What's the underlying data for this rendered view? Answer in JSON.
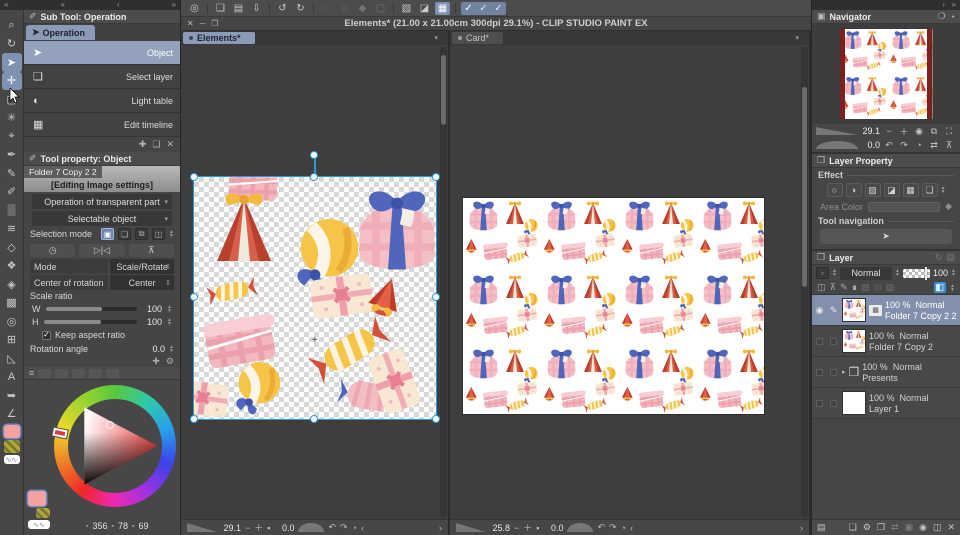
{
  "colors": {
    "accent_blue": "#8b9ab5",
    "handle_blue": "#2b98dd",
    "current_color": "#f2a3a1",
    "canvas_white": "#ffffff"
  },
  "window": {
    "title": "Elements* (21.00 x 21.00cm 300dpi 29.1%)  - CLIP STUDIO PAINT EX",
    "close": "✕",
    "minimize": "─",
    "maximize": "❐"
  },
  "top_strip": {
    "l1": "«",
    "l2": "«",
    "l3": "‹",
    "r1": "»",
    "nav_r1": "›",
    "nav_r2": "»"
  },
  "command_bar": {
    "icons": [
      {
        "name": "clip-studio-logo",
        "glyph": "◎"
      },
      {
        "name": "new-file",
        "glyph": "❑"
      },
      {
        "name": "open-file",
        "glyph": "▤"
      },
      {
        "name": "export",
        "glyph": "⇩"
      },
      {
        "name": "undo",
        "glyph": "↺"
      },
      {
        "name": "redo",
        "glyph": "↻"
      },
      {
        "name": "deselect",
        "glyph": "◌"
      },
      {
        "name": "reselect",
        "glyph": "○"
      },
      {
        "name": "invert-selection",
        "glyph": "◆"
      },
      {
        "name": "expand-selection",
        "glyph": "▢"
      },
      {
        "name": "selection-launcher",
        "glyph": "▧"
      },
      {
        "name": "crop",
        "glyph": "◪"
      },
      {
        "name": "show-grid",
        "glyph": "▦"
      },
      {
        "name": "snap-to-ruler",
        "glyph": "✓"
      },
      {
        "name": "snap-to-special-ruler",
        "glyph": "✓"
      },
      {
        "name": "snap-to-grid",
        "glyph": "✓"
      }
    ]
  },
  "tools": [
    {
      "name": "zoom",
      "glyph": "⌕"
    },
    {
      "name": "rotate-view",
      "glyph": "↻"
    },
    {
      "name": "object",
      "glyph": "➤"
    },
    {
      "name": "move-layer",
      "glyph": "✛"
    },
    {
      "name": "selection-marquee",
      "glyph": "▢"
    },
    {
      "name": "auto-select",
      "glyph": "✳"
    },
    {
      "name": "eyedropper",
      "glyph": "⌖"
    },
    {
      "name": "pen",
      "glyph": "✒"
    },
    {
      "name": "pencil",
      "glyph": "✎"
    },
    {
      "name": "brush",
      "glyph": "✐"
    },
    {
      "name": "airbrush",
      "glyph": "▒"
    },
    {
      "name": "decoration",
      "glyph": "≋"
    },
    {
      "name": "eraser",
      "glyph": "◇"
    },
    {
      "name": "blend",
      "glyph": "❖"
    },
    {
      "name": "fill",
      "glyph": "◈"
    },
    {
      "name": "gradient",
      "glyph": "▩"
    },
    {
      "name": "blur",
      "glyph": "◎"
    },
    {
      "name": "frame-border",
      "glyph": "⊞"
    },
    {
      "name": "figure",
      "glyph": "◺"
    },
    {
      "name": "text",
      "glyph": "A"
    },
    {
      "name": "balloon",
      "glyph": "➥"
    },
    {
      "name": "ruler",
      "glyph": "∠"
    }
  ],
  "swatch": {
    "transparent_waves": "∿∿"
  },
  "subtool": {
    "title": "Sub Tool: Operation",
    "group": "Operation",
    "group_icon": "➤",
    "items": [
      {
        "glyph": "➤",
        "label": "Object"
      },
      {
        "glyph": "❏",
        "label": "Select layer"
      },
      {
        "glyph": "◐",
        "label": "Light table"
      },
      {
        "glyph": "▦",
        "label": "Edit timeline"
      }
    ],
    "footer": {
      "add": "✚",
      "copy": "❏",
      "delete": "✕"
    }
  },
  "tool_property": {
    "title": "Tool property: Object",
    "target": "Folder 7 Copy 2 2",
    "banner": "[Editing Image settings]",
    "dropdown1": "Operation of transparent part",
    "dropdown2": "Selectable object",
    "selection_mode_label": "Selection mode",
    "mode_buttons": {
      "b1": "▣",
      "b2": "❏",
      "b3": "⧉",
      "b4": "◫"
    },
    "action_buttons": {
      "b1": "◷",
      "b2": "▷|◁",
      "b3": "⊼"
    },
    "mode_label": "Mode",
    "mode_value": "Scale/Rotate",
    "center_label": "Center of rotation",
    "center_value": "Center",
    "scale_label": "Scale ratio",
    "w_label": "W",
    "w_value": "100",
    "h_label": "H",
    "h_value": "100",
    "keep_aspect_label": "Keep aspect ratio",
    "check": "✓",
    "rotation_label": "Rotation angle",
    "rotation_value": "0.0",
    "footer": {
      "add": "✚",
      "wrench": "⚙"
    }
  },
  "color_panel": {
    "menu": "≡",
    "h": "356",
    "s": "78",
    "v": "69",
    "vicon": "▪"
  },
  "docs": [
    {
      "tab": "Elements*",
      "zoom": "29.1",
      "rotation": "0.0"
    },
    {
      "tab": "Card*",
      "zoom": "25.8",
      "rotation": "0.0"
    }
  ],
  "doc_status": {
    "minus": "−",
    "plus": "＋",
    "fit": "▪",
    "undo": "↶",
    "redo": "↷",
    "reset": "◔",
    "back": "‹",
    "fwd": "›"
  },
  "navigator": {
    "title": "Navigator",
    "zoom": "29.1",
    "rotation": "0.0",
    "icons": {
      "minus": "−",
      "plus": "＋",
      "actual": "◉",
      "fit1": "⧉",
      "fit2": "⛶",
      "rotl": "↶",
      "rotr": "↷",
      "reset": "◔",
      "fliph": "⇄",
      "flipv": "⊼"
    }
  },
  "layer_property": {
    "title": "Layer Property",
    "effect_label": "Effect",
    "effect_icons": {
      "i1": "○",
      "i2": "◑",
      "i3": "▨",
      "i4": "◪",
      "i5": "▦",
      "i6": "❏"
    },
    "area_color_label": "Area Color",
    "paint_icon": "◆",
    "tool_nav_label": "Tool navigation",
    "tool_nav_icon": "➤"
  },
  "layer_panel": {
    "title": "Layer",
    "blend_mode": "Normal",
    "opacity": "100",
    "lock_icons": {
      "i1": "◫",
      "i2": "⊼",
      "i3": "✎",
      "i4": "∎",
      "i5": "▧",
      "i6": "◎",
      "i7": "▨",
      "i8": "◧"
    },
    "rows": [
      {
        "pct": "100 %",
        "mode": "Normal",
        "name": "Folder 7 Copy 2 2"
      },
      {
        "pct": "100 %",
        "mode": "Normal",
        "name": "Folder 7 Copy 2"
      },
      {
        "pct": "100 %",
        "mode": "Normal",
        "name": "Presents"
      },
      {
        "pct": "100 %",
        "mode": "Normal",
        "name": "Layer 1"
      }
    ],
    "eye": "◉",
    "pencil": "✎",
    "folder_arrow": "▸",
    "folder": "❒",
    "footer": {
      "i1": "▤",
      "i2": "❑",
      "i3": "⚙",
      "i4": "❒",
      "i5": "⇄",
      "i6": "▣",
      "i7": "◉",
      "i8": "◫",
      "i9": "✕"
    }
  }
}
